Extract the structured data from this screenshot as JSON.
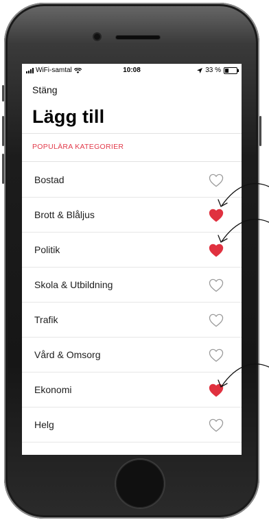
{
  "status_bar": {
    "carrier": "WiFi-samtal",
    "time": "10:08",
    "battery": "33 %"
  },
  "header": {
    "close_label": "Stäng",
    "title": "Lägg till"
  },
  "section": {
    "title": "POPULÄRA KATEGORIER"
  },
  "categories": [
    {
      "label": "Bostad",
      "favorited": false
    },
    {
      "label": "Brott & Blåljus",
      "favorited": true
    },
    {
      "label": "Politik",
      "favorited": true
    },
    {
      "label": "Skola & Utbildning",
      "favorited": false
    },
    {
      "label": "Trafik",
      "favorited": false
    },
    {
      "label": "Vård & Omsorg",
      "favorited": false
    },
    {
      "label": "Ekonomi",
      "favorited": true
    },
    {
      "label": "Helg",
      "favorited": false
    }
  ],
  "colors": {
    "accent": "#e23a4a",
    "heart_filled": "#e0313f",
    "heart_outline": "#9a9a9a"
  }
}
